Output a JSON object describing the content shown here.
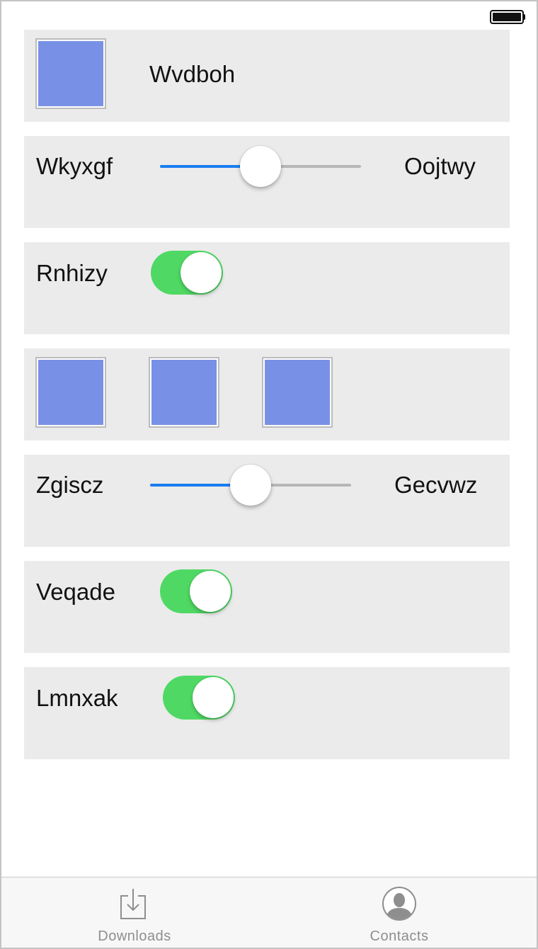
{
  "status_bar": {
    "battery_icon": "battery-full-icon"
  },
  "rows": {
    "image_row_1": {
      "label": "Wvdboh",
      "image_color": "#7891e6"
    },
    "slider_row_1": {
      "left_label": "Wkyxgf",
      "right_label": "Oojtwy",
      "value": 0.5
    },
    "toggle_row_1": {
      "label": "Rnhizy",
      "on": true
    },
    "image_row_2": {
      "image_count": 3,
      "image_color": "#7891e6"
    },
    "slider_row_2": {
      "left_label": "Zgiscz",
      "right_label": "Gecvwz",
      "value": 0.5
    },
    "toggle_row_2": {
      "label": "Veqade",
      "on": true
    },
    "toggle_row_3": {
      "label": "Lmnxak",
      "on": true
    }
  },
  "tab_bar": {
    "tabs": [
      {
        "label": "Downloads",
        "icon": "downloads-icon"
      },
      {
        "label": "Contacts",
        "icon": "contacts-icon"
      }
    ]
  },
  "colors": {
    "row_background": "#ebebeb",
    "slider_active": "#1a7ef0",
    "toggle_on": "#4fd964",
    "image_fill": "#7891e6"
  }
}
